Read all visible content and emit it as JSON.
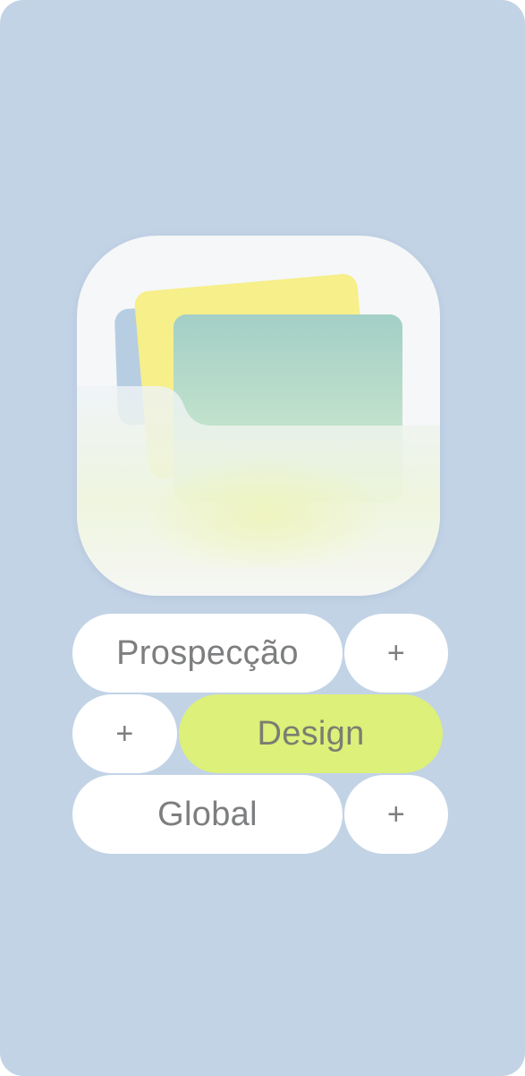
{
  "app_icon": {
    "name": "folder-cards-icon",
    "colors": {
      "background": "#f6f7f8",
      "sheet_blue": "#b7cde2",
      "sheet_yellow": "#f6ef8a",
      "sheet_teal": "#a3cfc7",
      "pocket_tint": "#e8f3c8"
    }
  },
  "chips": [
    {
      "label": "Prospecção",
      "selected": false
    },
    {
      "label": "+",
      "selected": false
    },
    {
      "label": "+",
      "selected": false
    },
    {
      "label": "Design",
      "selected": true
    },
    {
      "label": "Global",
      "selected": false
    },
    {
      "label": "+",
      "selected": false
    }
  ],
  "colors": {
    "page_background": "#c2d3e6",
    "chip_background": "#ffffff",
    "chip_selected_background": "#dcf07a",
    "chip_text": "#7d7e7f"
  }
}
